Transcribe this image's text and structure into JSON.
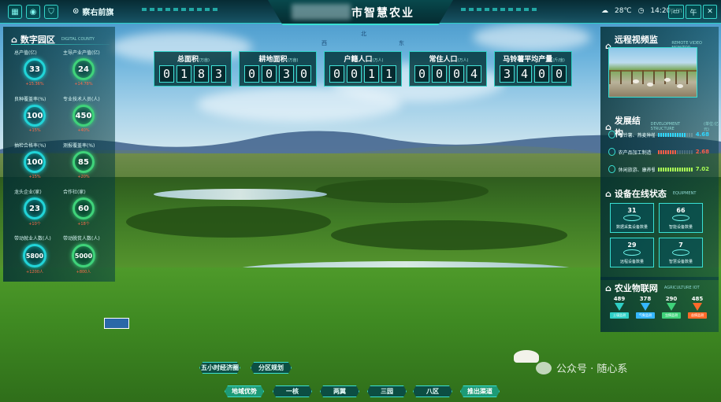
{
  "topbar": {
    "location": "察右前旗",
    "title": "市智慧农业",
    "weather": {
      "temperature": "28℃",
      "time": "14:20pm"
    },
    "right_button_label": "午",
    "icons": [
      "dashboard-icon",
      "globe-icon",
      "shield-icon",
      "location-pin-icon",
      "weather-icon",
      "clock-icon",
      "screen-icon",
      "close-icon"
    ]
  },
  "compass": {
    "north": "北",
    "west": "西",
    "east": "东"
  },
  "digital_park": {
    "title": "数字园区",
    "subtitle": "DIGITAL COUNTY",
    "metrics": [
      {
        "label": "总产值(亿)",
        "value": "33",
        "delta": "+15.36%",
        "color": "cyan"
      },
      {
        "label": "主导产业产值(亿)",
        "value": "24",
        "delta": "+14.78%",
        "color": "green"
      },
      {
        "label": "良种覆盖率(%)",
        "value": "100",
        "delta": "+15%",
        "color": "cyan"
      },
      {
        "label": "专业技术人员(人)",
        "value": "450",
        "delta": "+40%",
        "color": "green"
      },
      {
        "label": "抽检合格率(%)",
        "value": "100",
        "delta": "+15%",
        "color": "cyan"
      },
      {
        "label": "测报覆盖率(%)",
        "value": "85",
        "delta": "+20%",
        "color": "green"
      },
      {
        "label": "龙头企业(家)",
        "value": "23",
        "delta": "+10个",
        "color": "cyan"
      },
      {
        "label": "合作社(家)",
        "value": "60",
        "delta": "+18个",
        "color": "green"
      },
      {
        "label": "带动就业人数(人)",
        "value": "5800",
        "delta": "+1200人",
        "color": "cyan"
      },
      {
        "label": "带动脱贫人数(人)",
        "value": "5000",
        "delta": "+800人",
        "color": "green"
      }
    ]
  },
  "kpis": [
    {
      "label": "总面积",
      "unit": "(万亩)",
      "digits": [
        "0",
        "1",
        "8",
        "3"
      ]
    },
    {
      "label": "耕地面积",
      "unit": "(万亩)",
      "digits": [
        "0",
        "0",
        "3",
        "0"
      ]
    },
    {
      "label": "户籍人口",
      "unit": "(万人)",
      "digits": [
        "0",
        "0",
        "1",
        "1"
      ]
    },
    {
      "label": "常住人口",
      "unit": "(万人)",
      "digits": [
        "0",
        "0",
        "0",
        "4"
      ]
    },
    {
      "label": "马铃薯平均产量",
      "unit": "(斤/亩)",
      "digits": [
        "3",
        "4",
        "0",
        "0"
      ]
    }
  ],
  "video_monitor": {
    "title": "远程视频监控",
    "subtitle": "REMOTE VIDEO MONITOR"
  },
  "development": {
    "title": "发展结构",
    "subtitle": "DEVELOPMENT STRUCTURE",
    "unit": "(单位:亿元)",
    "rows": [
      {
        "label": "马铃薯、燕麦种植",
        "value": "4.68",
        "color": "#2fd7ff",
        "filled": 12
      },
      {
        "label": "农产品加工制造",
        "value": "2.68",
        "color": "#ff5f45",
        "filled": 8
      },
      {
        "label": "休闲旅游、康养餐饮",
        "value": "7.02",
        "color": "#aaff55",
        "filled": 15
      }
    ]
  },
  "equipment": {
    "title": "设备在线状态",
    "subtitle": "EQUIPMENT",
    "tiles": [
      {
        "value": "31",
        "label": "数据采集设备数量"
      },
      {
        "value": "66",
        "label": "智能设备数量"
      },
      {
        "value": "29",
        "label": "远程设备数量"
      },
      {
        "value": "7",
        "label": "智慧设备数量"
      }
    ]
  },
  "iot": {
    "title": "农业物联网",
    "subtitle": "AGRICULTURE IOT",
    "items": [
      {
        "value": "489",
        "label": "土壤监测",
        "color": "#2fd0c6"
      },
      {
        "value": "378",
        "label": "气象监测",
        "color": "#35b7ff"
      },
      {
        "value": "290",
        "label": "虫情监测",
        "color": "#3fd37a"
      },
      {
        "value": "485",
        "label": "苗情监测",
        "color": "#ff6a2a"
      }
    ]
  },
  "bottom_nav": {
    "upper": [
      "五小时经济圈",
      "分区规划"
    ],
    "lower": [
      "地域优势",
      "一核",
      "两翼",
      "三园",
      "八区",
      "推出渠道"
    ]
  },
  "watermark": {
    "text": "公众号 · 随心系"
  }
}
